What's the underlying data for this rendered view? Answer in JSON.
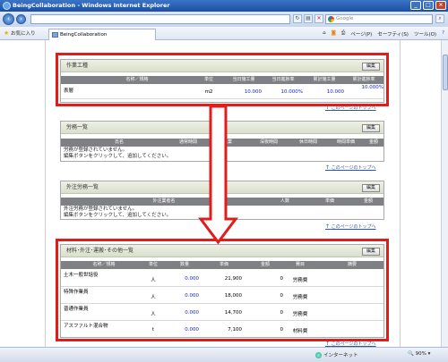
{
  "window": {
    "title": "BeingCollaboration - Windows Internet Explorer"
  },
  "address": {
    "url": "",
    "search_placeholder": "Google"
  },
  "commandbar": {
    "favorites_label": "お気に入り",
    "tab_title": "BeingCollaboration",
    "page_menu": "ページ(P)",
    "safety_menu": "セーフティ(S)",
    "tools_menu": "ツール(O)"
  },
  "common": {
    "edit_label": "編集",
    "page_top_link": "このページのトップへ"
  },
  "work_panel": {
    "title": "作業工種",
    "headers": [
      "名称／規格",
      "単位",
      "当日施工量",
      "当日進捗率",
      "累計施工量",
      "累計進捗率"
    ],
    "rows": [
      {
        "name": "表層",
        "unit": "m2",
        "today_qty": "10.000",
        "today_rate": "10.000%",
        "total_qty": "10.000",
        "total_rate": "10.000%"
      }
    ]
  },
  "labor_panel": {
    "title": "労務一覧",
    "headers": [
      "氏名",
      "通常時間",
      "残業",
      "深夜時間",
      "休日時間",
      "時間単価",
      "金額"
    ],
    "messages": [
      "労務が登録されていません。",
      "編集ボタンをクリックして、追加してください。"
    ]
  },
  "subcon_panel": {
    "title": "外注労務一覧",
    "headers": [
      "外注業者名",
      "人数",
      "単価",
      "金額"
    ],
    "messages": [
      "外注労務が登録されていません。",
      "編集ボタンをクリックして、追加してください。"
    ]
  },
  "material_panel": {
    "title": "材料･外注･運搬･その他一覧",
    "headers": [
      "名称／規格",
      "単位",
      "数量",
      "単価",
      "金額",
      "費目",
      "摘要"
    ],
    "rows": [
      {
        "name": "土木一般世話役",
        "unit": "人",
        "qty": "0.000",
        "price": "21,900",
        "amount": "0",
        "category": "労務費"
      },
      {
        "name": "特殊作業員",
        "unit": "人",
        "qty": "0.000",
        "price": "18,000",
        "amount": "0",
        "category": "労務費"
      },
      {
        "name": "普通作業員",
        "unit": "人",
        "qty": "0.000",
        "price": "14,700",
        "amount": "0",
        "category": "労務費"
      },
      {
        "name": "アスファルト混合物",
        "unit": "t",
        "qty": "0.000",
        "price": "7,100",
        "amount": "0",
        "category": "材料費"
      }
    ]
  },
  "status": {
    "zone": "インターネット",
    "zoom": "90%"
  },
  "colors": {
    "highlight": "#e21b1b",
    "table_header": "#7f8083",
    "link": "#2a55b8",
    "value": "#0b1fd0"
  }
}
